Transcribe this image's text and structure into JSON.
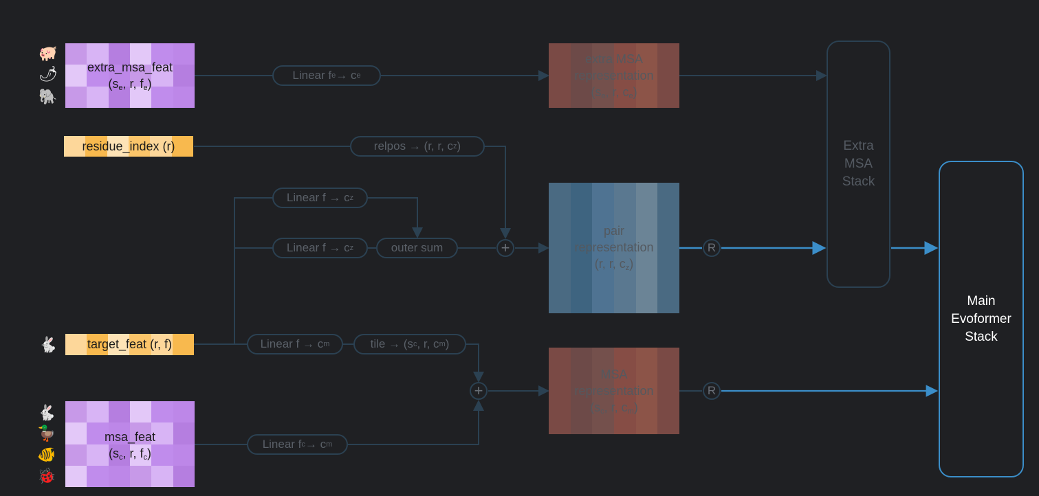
{
  "inputs": {
    "extra_msa_feat": {
      "name": "extra_msa_feat",
      "dims_pre": "(s",
      "sub1": "e",
      "dims_mid": ", r, f",
      "sub2": "e",
      "dims_post": ")"
    },
    "residue_index": {
      "label": "residue_index (r)"
    },
    "target_feat": {
      "label": "target_feat (r, f)"
    },
    "msa_feat": {
      "name": "msa_feat",
      "dims_pre": "(s",
      "sub1": "c",
      "dims_mid": ", r, f",
      "sub2": "c",
      "dims_post": ")"
    }
  },
  "ops": {
    "linear_fe": {
      "pre": "Linear f",
      "sub1": "e",
      "mid": " → c",
      "sub2": "e"
    },
    "relpos": {
      "pre": "relpos → (r, r, c",
      "sub": "z",
      "post": ")"
    },
    "linear_cz_1": {
      "pre": "Linear f → c",
      "sub": "z"
    },
    "linear_cz_2": {
      "pre": "Linear f → c",
      "sub": "z"
    },
    "outer_sum": {
      "label": "outer sum"
    },
    "linear_cm": {
      "pre": "Linear f → c",
      "sub": "m"
    },
    "tile": {
      "pre": "tile → (s",
      "sub1": "c",
      "mid": ", r, c",
      "sub2": "m",
      "post": ")"
    },
    "linear_fc": {
      "pre": "Linear f",
      "sub1": "c",
      "mid": " → c",
      "sub2": "m"
    },
    "plus_symbol": "+",
    "recycle_symbol": "R"
  },
  "representations": {
    "extra_msa": {
      "line1": "extra MSA",
      "line2": "representation",
      "pre": "(s",
      "sub1": "e",
      "mid": ", r, c",
      "sub2": "e",
      "post": ")"
    },
    "pair": {
      "line1": "pair",
      "line2": "representation",
      "pre": "(r, r, c",
      "sub": "z",
      "post": ")"
    },
    "msa": {
      "line1": "MSA",
      "line2": "representation",
      "pre": "(s",
      "sub1": "c",
      "mid": ", r, c",
      "sub2": "m",
      "post": ")"
    }
  },
  "stacks": {
    "extra_msa_stack": {
      "line1": "Extra",
      "line2": "MSA",
      "line3": "Stack"
    },
    "main_evoformer": {
      "line1": "Main",
      "line2": "Evoformer",
      "line3": "Stack"
    }
  },
  "icons": {
    "extra_msa": [
      "pig-icon",
      "pepper-icon",
      "elephant-icon"
    ],
    "target": [
      "rabbit-icon"
    ],
    "msa": [
      "rabbit-icon",
      "duck-icon",
      "fish-icon",
      "bug-icon"
    ]
  },
  "colors": {
    "background": "#1f2023",
    "arrow_dim": "#2b4152",
    "arrow_bright": "#3b8ec9",
    "purple": [
      "#c799e8",
      "#d8b4f5",
      "#b57ee0",
      "#e3c8f8",
      "#c08cec",
      "#bd87e8"
    ],
    "orange": [
      "#fdd79a",
      "#fbc56a",
      "#fde3b6",
      "#f8b94e"
    ],
    "red": [
      "#7a4a45",
      "#864d45",
      "#6d4a48",
      "#8c5448",
      "#74504c"
    ],
    "blue": [
      "#4a6a82",
      "#5a7890",
      "#3e6480",
      "#6b8496",
      "#4f7392"
    ]
  }
}
